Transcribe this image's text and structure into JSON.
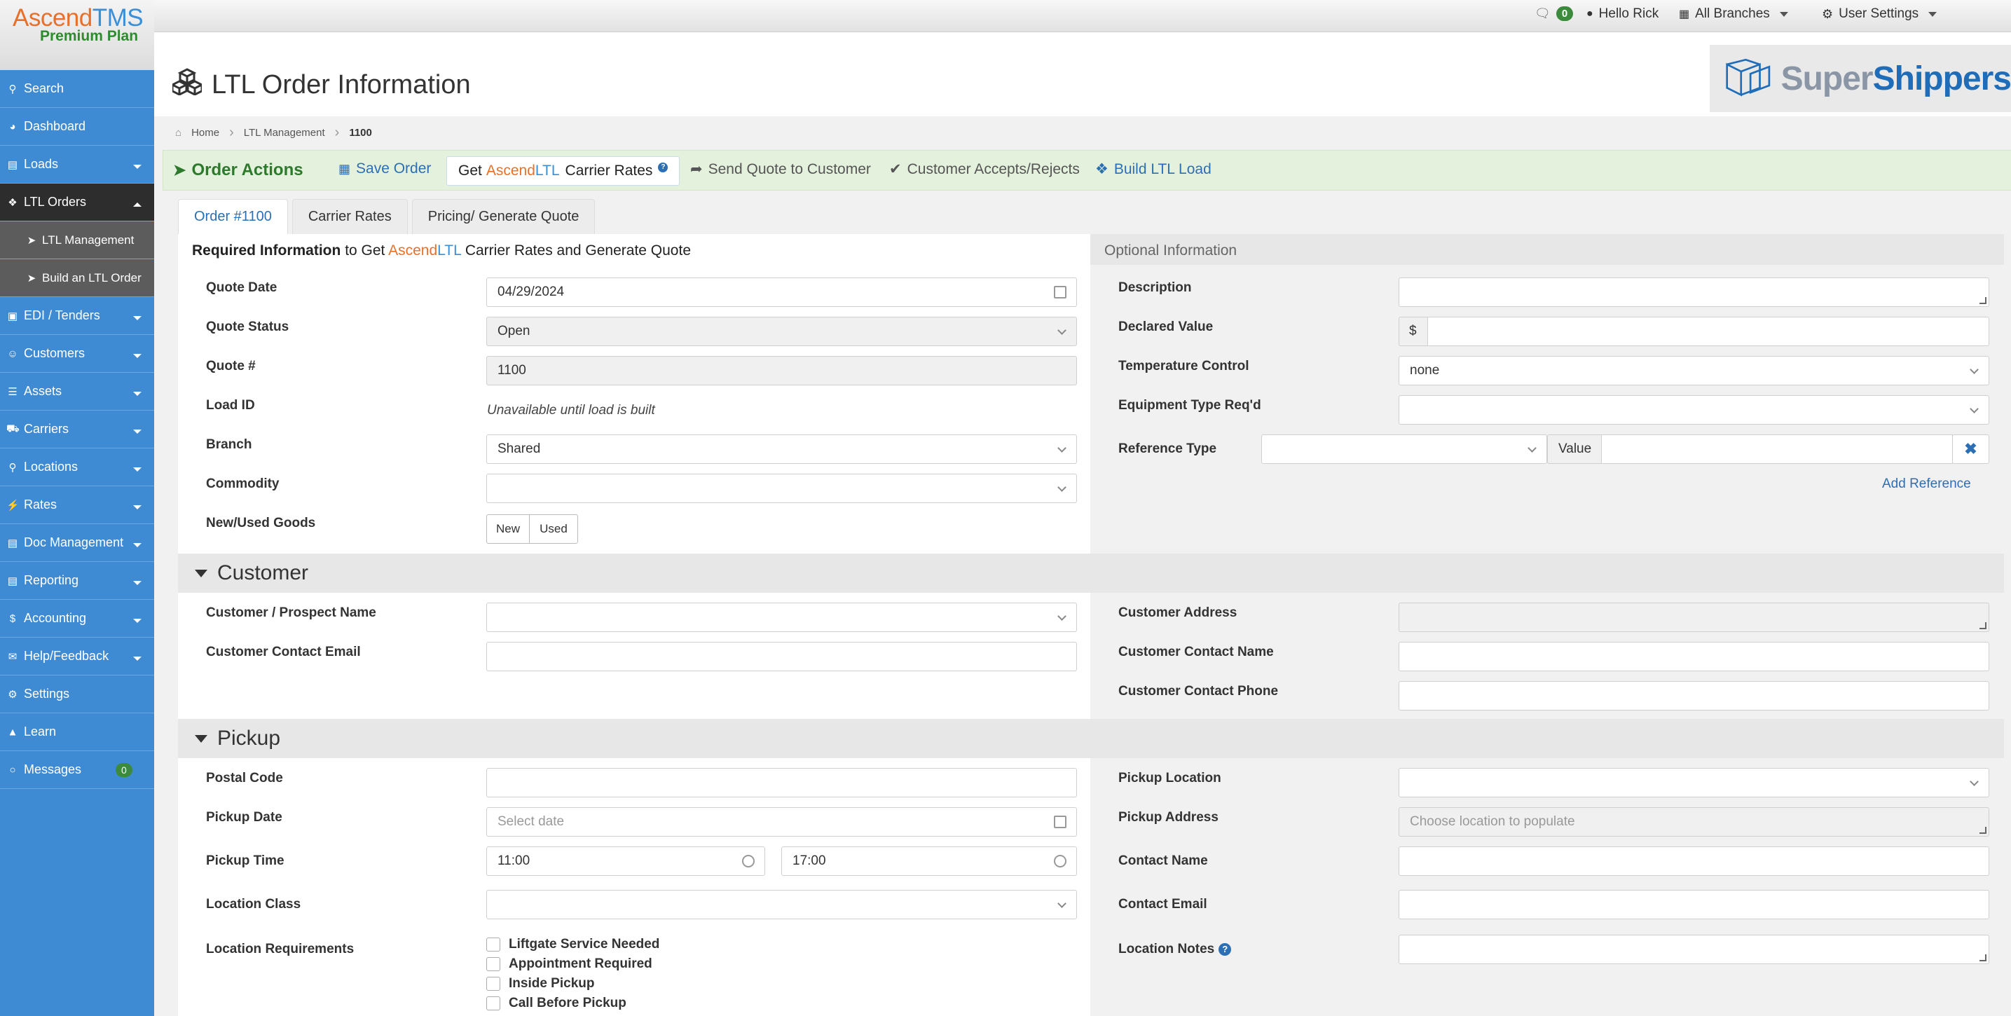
{
  "brand": {
    "name_part1": "Ascend",
    "name_part2": "TMS",
    "plan": "Premium Plan"
  },
  "topnav": {
    "messages_count": "0",
    "greeting": "Hello Rick",
    "branches": "All Branches",
    "settings": "User Settings"
  },
  "sidebar": {
    "items": [
      {
        "label": "Search",
        "icon": "search-icon"
      },
      {
        "label": "Dashboard",
        "icon": "dashboard-icon"
      },
      {
        "label": "Loads",
        "icon": "loads-icon"
      },
      {
        "label": "LTL Orders",
        "icon": "ltl-orders-icon"
      },
      {
        "label": "LTL Management",
        "icon": "circle-arrow-icon"
      },
      {
        "label": "Build an LTL Order",
        "icon": "circle-arrow-icon"
      },
      {
        "label": "EDI / Tenders",
        "icon": "inbox-icon"
      },
      {
        "label": "Customers",
        "icon": "users-icon"
      },
      {
        "label": "Assets",
        "icon": "barcode-icon"
      },
      {
        "label": "Carriers",
        "icon": "truck-icon"
      },
      {
        "label": "Locations",
        "icon": "map-pin-icon"
      },
      {
        "label": "Rates",
        "icon": "bolt-icon"
      },
      {
        "label": "Doc Management",
        "icon": "document-icon"
      },
      {
        "label": "Reporting",
        "icon": "report-icon"
      },
      {
        "label": "Accounting",
        "icon": "dollar-icon"
      },
      {
        "label": "Help/Feedback",
        "icon": "bullhorn-icon"
      },
      {
        "label": "Settings",
        "icon": "gears-icon"
      },
      {
        "label": "Learn",
        "icon": "graduation-cap-icon"
      },
      {
        "label": "Messages",
        "icon": "chat-icon",
        "badge": "0"
      }
    ]
  },
  "page": {
    "title": "LTL Order Information",
    "partner_logo_part1": "Super",
    "partner_logo_part2": "Shippers"
  },
  "breadcrumb": {
    "home": "Home",
    "section": "LTL Management",
    "current": "1100"
  },
  "actions": {
    "title": "Order Actions",
    "save": "Save Order",
    "get_rates_prefix": "Get",
    "get_rates_ascend": "Ascend",
    "get_rates_ltl": "LTL",
    "get_rates_suffix": "Carrier Rates",
    "send_quote": "Send Quote to Customer",
    "accepts": "Customer Accepts/Rejects",
    "build": "Build LTL Load"
  },
  "tabs": [
    "Order #1100",
    "Carrier Rates",
    "Pricing/ Generate Quote"
  ],
  "required": {
    "heading_bold": "Required Information",
    "heading_mid": "to Get",
    "heading_ascend": "Ascend",
    "heading_ltl": "LTL",
    "heading_end": "Carrier Rates and Generate Quote",
    "quote_date_label": "Quote Date",
    "quote_date": "04/29/2024",
    "quote_status_label": "Quote Status",
    "quote_status": "Open",
    "quote_no_label": "Quote #",
    "quote_no": "1100",
    "load_id_label": "Load ID",
    "load_id": "Unavailable until load is built",
    "branch_label": "Branch",
    "branch": "Shared",
    "commodity_label": "Commodity",
    "commodity": "",
    "goods_label": "New/Used Goods",
    "goods_new": "New",
    "goods_used": "Used"
  },
  "optional": {
    "heading": "Optional Information",
    "description_label": "Description",
    "declared_value_label": "Declared Value",
    "currency": "$",
    "temp_label": "Temperature Control",
    "temp": "none",
    "equipment_label": "Equipment Type Req'd",
    "reference_label": "Reference Type",
    "reference_value_label": "Value",
    "add_reference": "Add Reference"
  },
  "customer": {
    "title": "Customer",
    "name_label": "Customer / Prospect Name",
    "email_label": "Customer Contact Email",
    "address_label": "Customer Address",
    "contact_name_label": "Customer Contact Name",
    "contact_phone_label": "Customer Contact Phone"
  },
  "pickup": {
    "title": "Pickup",
    "postal_label": "Postal Code",
    "date_label": "Pickup Date",
    "date_placeholder": "Select date",
    "time_label": "Pickup Time",
    "time_from": "11:00",
    "time_to": "17:00",
    "class_label": "Location Class",
    "req_label": "Location Requirements",
    "requirements": [
      "Liftgate Service Needed",
      "Appointment Required",
      "Inside Pickup",
      "Call Before Pickup"
    ],
    "location_label": "Pickup Location",
    "address_label": "Pickup Address",
    "address_placeholder": "Choose location to populate",
    "contact_name_label": "Contact Name",
    "contact_email_label": "Contact Email",
    "notes_label": "Location Notes"
  }
}
